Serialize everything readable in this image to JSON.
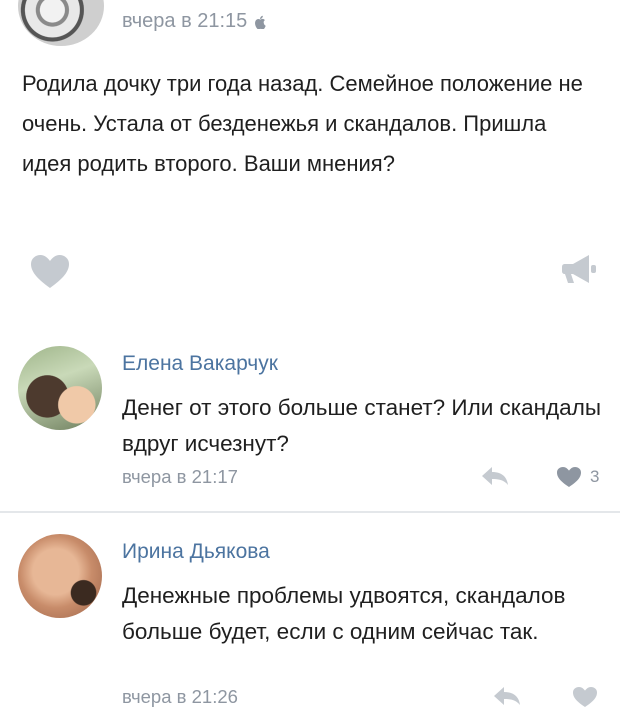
{
  "post": {
    "timestamp": "вчера в 21:15",
    "platform_icon": "apple-icon",
    "text": "Родила дочку три года назад. Семейное положение не очень. Устала от безденежья и скандалов. Пришла идея родить второго. Ваши мнения?",
    "like_icon": "heart-icon",
    "share_icon": "megaphone-icon"
  },
  "comments": [
    {
      "author": "Елена Вакарчук",
      "text": "Денег от этого больше станет? Или скандалы вдруг исчезнут?",
      "time": "вчера в 21:17",
      "likes": "3",
      "reply_icon": "reply-icon",
      "like_icon": "heart-icon"
    },
    {
      "author": "Ирина Дьякова",
      "text": "Денежные проблемы удвоятся, скандалов больше будет, если с одним сейчас так.",
      "time": "вчера в 21:26",
      "reply_icon": "reply-icon",
      "like_icon": "heart-icon"
    }
  ],
  "colors": {
    "author_link": "#4c74a0",
    "meta_gray": "#8e96a1",
    "icon_gray": "#c5cad0",
    "divider": "#e4e7ea"
  }
}
